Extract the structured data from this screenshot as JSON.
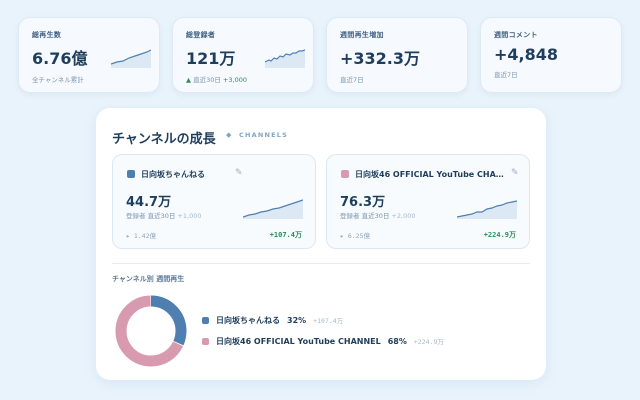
{
  "stats": [
    {
      "label": "総再生数",
      "value": "6.76億",
      "sub": "全チャンネル累計"
    },
    {
      "label": "総登録者",
      "value": "121万",
      "sub_arrow": "▲",
      "sub_main": "直近30日",
      "sub_delta": "+3,000"
    },
    {
      "label": "週間再生増加",
      "value": "+332.3万",
      "sub": "直近7日"
    },
    {
      "label": "週間コメント",
      "value": "+4,848",
      "sub": "直近7日"
    }
  ],
  "panel": {
    "title": "チャンネルの成長",
    "diamond": "◆",
    "title_en": "CHANNELS"
  },
  "channels": [
    {
      "name": "日向坂ちゃんねる",
      "color": "#4f7fb0",
      "edit_icon": "pencil-icon",
      "value": "44.7万",
      "sub_main": "登録者 直近30日",
      "sub_delta": "+1,000",
      "views": "1.42億",
      "views_icon": "▸",
      "growth": "+107.4万"
    },
    {
      "name": "日向坂46 OFFICIAL YouTube CHA…",
      "color": "#d89aae",
      "edit_icon": "pencil-icon",
      "value": "76.3万",
      "sub_main": "登録者 直近30日",
      "sub_delta": "+2,000",
      "views": "6.25億",
      "views_icon": "▸",
      "growth": "+224.9万"
    }
  ],
  "weekly": {
    "title": "チャンネル別 週間再生",
    "items": [
      {
        "name": "日向坂ちゃんねる",
        "pct": "32%",
        "share": 0.32,
        "growth": "+107.4万",
        "color": "#4f7fb0"
      },
      {
        "name": "日向坂46 OFFICIAL YouTube CHANNEL",
        "pct": "68%",
        "share": 0.68,
        "growth": "+224.9万",
        "color": "#d89aae"
      }
    ]
  }
}
